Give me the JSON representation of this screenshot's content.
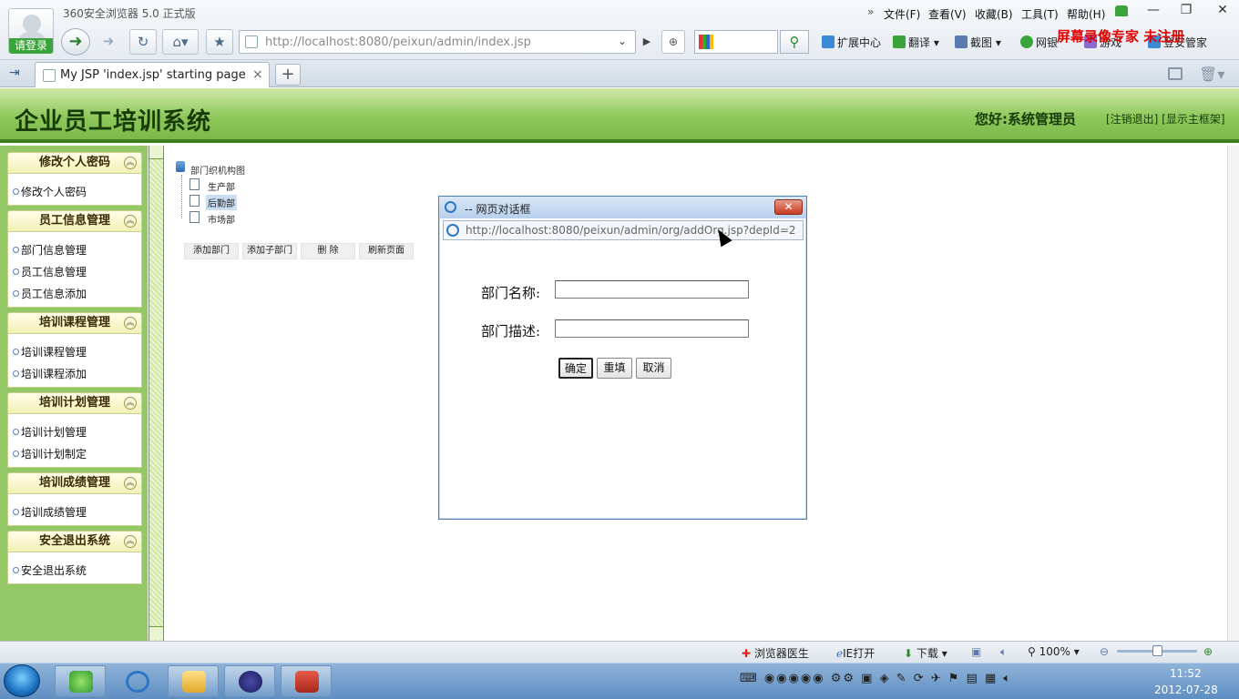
{
  "browser": {
    "title": "360安全浏览器 5.0 正式版",
    "login_label": "请登录",
    "menu": [
      "文件(F)",
      "查看(V)",
      "收藏(B)",
      "工具(T)",
      "帮助(H)"
    ],
    "menu_chevron": "»",
    "address": "http://localhost:8080/peixun/admin/index.jsp",
    "toolbar": {
      "extensions": "扩展中心",
      "translate": "翻译",
      "screenshot": "截图",
      "netbank": "网银",
      "games": "游戏",
      "safety": "登安管家"
    },
    "watermark": "屏幕录像专家 未注册",
    "tab_title": "My JSP 'index.jsp' starting page",
    "tab_close": "×",
    "new_tab": "+"
  },
  "app": {
    "title": "企业员工培训系统",
    "greeting": "您好:系统管理员",
    "header_links": "[注销退出] [显示主框架]"
  },
  "sidebar": [
    {
      "title": "修改个人密码",
      "items": [
        "修改个人密码"
      ]
    },
    {
      "title": "员工信息管理",
      "items": [
        "部门信息管理",
        "员工信息管理",
        "员工信息添加"
      ]
    },
    {
      "title": "培训课程管理",
      "items": [
        "培训课程管理",
        "培训课程添加"
      ]
    },
    {
      "title": "培训计划管理",
      "items": [
        "培训计划管理",
        "培训计划制定"
      ]
    },
    {
      "title": "培训成绩管理",
      "items": [
        "培训成绩管理"
      ]
    },
    {
      "title": "安全退出系统",
      "items": [
        "安全退出系统"
      ]
    }
  ],
  "tree": {
    "root": "部门织机构图",
    "nodes": [
      "生产部",
      "后勤部",
      "市场部"
    ],
    "selected": "后勤部"
  },
  "actions": [
    "添加部门",
    "添加子部门",
    "删 除",
    "刷新页面"
  ],
  "dialog": {
    "title": "-- 网页对话框",
    "url": "http://localhost:8080/peixun/admin/org/addOrg.jsp?depId=2",
    "name_label": "部门名称:",
    "name_value": "",
    "desc_label": "部门描述:",
    "desc_value": "",
    "ok": "确定",
    "reset": "重填",
    "cancel": "取消",
    "close": "✕"
  },
  "status": {
    "doctor": "浏览器医生",
    "ie_open": "IE打开",
    "download": "下载",
    "zoom": "100%"
  },
  "clock": {
    "time": "11:52",
    "date": "2012-07-28"
  }
}
